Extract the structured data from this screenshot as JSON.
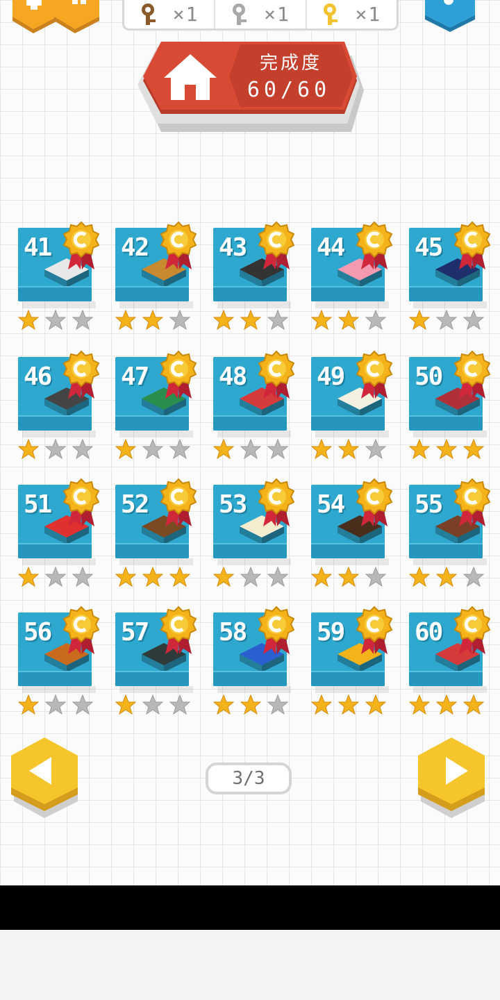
{
  "top_bar": {
    "keys": [
      {
        "icon": "bronze-key-icon",
        "color": "#8b5a2b",
        "count": "×1"
      },
      {
        "icon": "silver-key-icon",
        "color": "#a9a9a9",
        "count": "×1"
      },
      {
        "icon": "gold-key-icon",
        "color": "#f2c230",
        "count": "×1"
      }
    ]
  },
  "banner": {
    "title": "完成度",
    "progress": "60/60",
    "icon": "home-icon"
  },
  "levels": [
    {
      "number": "41",
      "stars": 1
    },
    {
      "number": "42",
      "stars": 2
    },
    {
      "number": "43",
      "stars": 2
    },
    {
      "number": "44",
      "stars": 2
    },
    {
      "number": "45",
      "stars": 1
    },
    {
      "number": "46",
      "stars": 1
    },
    {
      "number": "47",
      "stars": 1
    },
    {
      "number": "48",
      "stars": 1
    },
    {
      "number": "49",
      "stars": 2
    },
    {
      "number": "50",
      "stars": 3
    },
    {
      "number": "51",
      "stars": 1
    },
    {
      "number": "52",
      "stars": 3
    },
    {
      "number": "53",
      "stars": 1
    },
    {
      "number": "54",
      "stars": 2
    },
    {
      "number": "55",
      "stars": 2
    },
    {
      "number": "56",
      "stars": 1
    },
    {
      "number": "57",
      "stars": 1
    },
    {
      "number": "58",
      "stars": 2
    },
    {
      "number": "59",
      "stars": 3
    },
    {
      "number": "60",
      "stars": 3
    }
  ],
  "pagination": {
    "label": "3/3"
  },
  "colors": {
    "card": "#2fa8d0",
    "banner_red": "#d94a35",
    "star_gold": "#f4b21b",
    "star_gray": "#b8b8b8",
    "hex_yellow": "#f6c52c",
    "hex_orange": "#f5a623",
    "hex_blue": "#2f9fd8"
  }
}
